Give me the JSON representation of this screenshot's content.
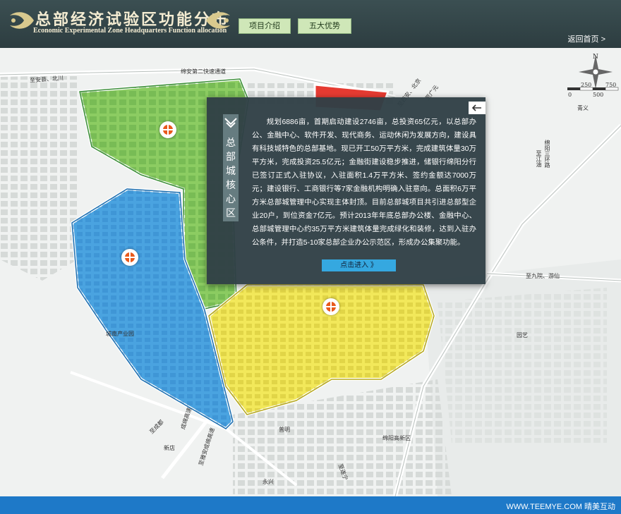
{
  "header": {
    "title_zh": "总部经济试验区功能分布",
    "title_en": "Economic Experimental Zone Headquarters Function allocation",
    "nav": [
      {
        "label": "项目介绍"
      },
      {
        "label": "五大优势"
      }
    ],
    "back_label": "返回首页 >"
  },
  "map": {
    "zone_colors": {
      "green": "#8ccc62",
      "blue": "#4aa3e0",
      "yellow": "#f2e85a",
      "red": "#e63b32"
    },
    "labels": {
      "road_pingan_beichuan": "至安县、北川",
      "road_mianan": "绵安第二快速通道",
      "road_xian_beichuan": "至西安、北京",
      "road_mianyang_gaosu": "绵阳高速",
      "road_guangyuan": "至广元",
      "road_pingtong": "至江油",
      "road_mianyang_third": "绵阳三环路",
      "road_jiulong": "至九院、游仙",
      "road_pingchengdu": "至成都",
      "road_chengmian": "成绵高速",
      "road_pingyaan": "至雅安成绵高速",
      "road_pingtai": "至遂宁",
      "place_qingyi": "青义",
      "place_chengshi": "城南产业园",
      "place_puming": "普明",
      "place_mianyang_gaoxin": "绵阳高新区",
      "place_yuanyi": "园艺",
      "place_yongxing": "永兴",
      "place_xinji": "新店"
    },
    "compass_letter": "N",
    "scale": {
      "top": [
        "250",
        "750"
      ],
      "bottom": [
        "0",
        "500"
      ]
    }
  },
  "popup": {
    "tag": "总部城核心区",
    "body": "规划6886亩，首期启动建设2746亩，总投资65亿元，以总部办公、金融中心、软件开发、现代商务、运动休闲为发展方向，建设具有科技城特色的总部基地。现已开工50万平方米，完成建筑体量30万平方米，完成投资25.5亿元；金融街建设稳步推进，储银行绵阳分行已签订正式入驻协议，入驻面积1.4万平方米、签约金额达7000万元；建设银行、工商银行等7家金融机构明确入驻意向。总面积6万平方米总部城管理中心实现主体封顶。目前总部城项目共引进总部型企业20户，到位资金7亿元。预计2013年年底总部办公楼、金融中心、总部城管理中心约35万平方米建筑体量完成绿化和装修，达到入驻办公条件，并打造5-10家总部企业办公示范区，形成办公集聚功能。",
    "enter_label": "点击进入 》",
    "close_icon": "arrow-left-icon"
  },
  "footer": {
    "text": "WWW.TEEMYE.COM 晴美互动"
  }
}
